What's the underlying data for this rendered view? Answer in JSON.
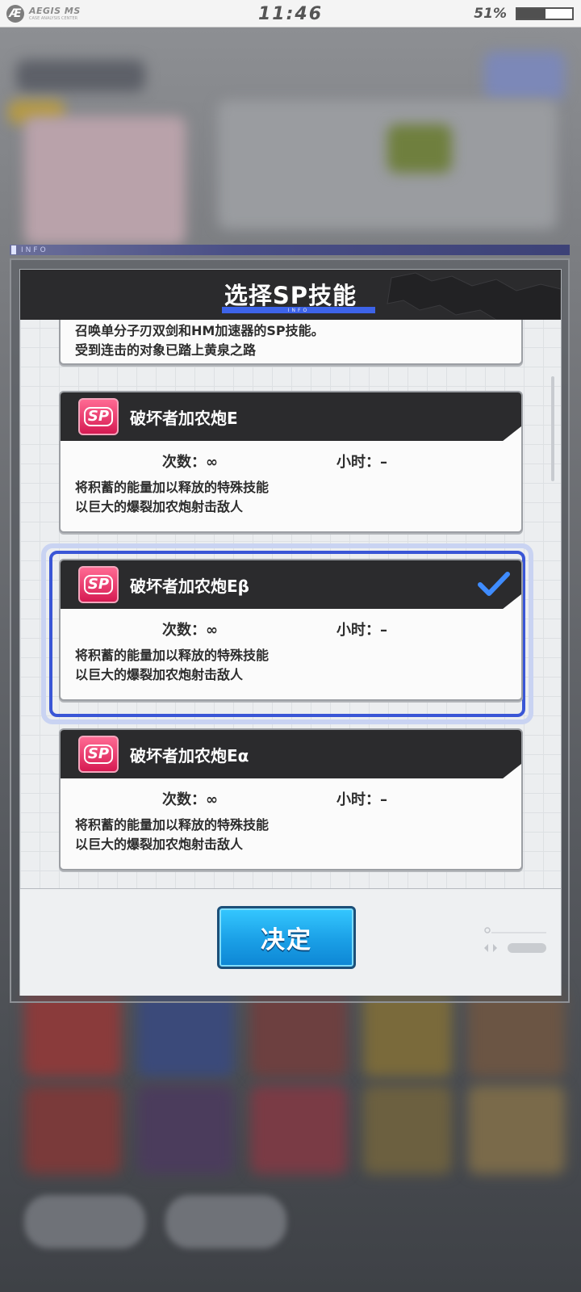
{
  "status_bar": {
    "logo_letter": "Æ",
    "logo_title": "AEGIS MS",
    "logo_subtitle": "CASE ANALYSIS CENTER",
    "time": "11:46",
    "battery_text": "51%",
    "battery_level": 0.51
  },
  "info_strip": {
    "label": "INFO"
  },
  "dialog": {
    "title": "选择SP技能",
    "title_bar_label": "INFO",
    "partial_card": {
      "desc_lines": [
        "召唤单分子刃双剑和HM加速器的SP技能。",
        "受到连击的对象已踏上黄泉之路"
      ]
    },
    "skills": [
      {
        "badge": "SP",
        "name": "破坏者加农炮E",
        "count_label": "次数：∞",
        "hours_label": "小时：–",
        "desc_lines": [
          "将积蓄的能量加以释放的特殊技能",
          "以巨大的爆裂加农炮射击敌人"
        ],
        "selected": false
      },
      {
        "badge": "SP",
        "name": "破坏者加农炮Eβ",
        "count_label": "次数：∞",
        "hours_label": "小时：–",
        "desc_lines": [
          "将积蓄的能量加以释放的特殊技能",
          "以巨大的爆裂加农炮射击敌人"
        ],
        "selected": true
      },
      {
        "badge": "SP",
        "name": "破坏者加农炮Eα",
        "count_label": "次数：∞",
        "hours_label": "小时：–",
        "desc_lines": [
          "将积蓄的能量加以释放的特殊技能",
          "以巨大的爆裂加农炮射击敌人"
        ],
        "selected": false
      }
    ],
    "confirm_label": "决定"
  },
  "colors": {
    "accent_blue": "#3d63e8",
    "confirm_button": "#1a9fe6",
    "sp_badge": "#e8386a",
    "header_dark": "#2b2b2d"
  }
}
